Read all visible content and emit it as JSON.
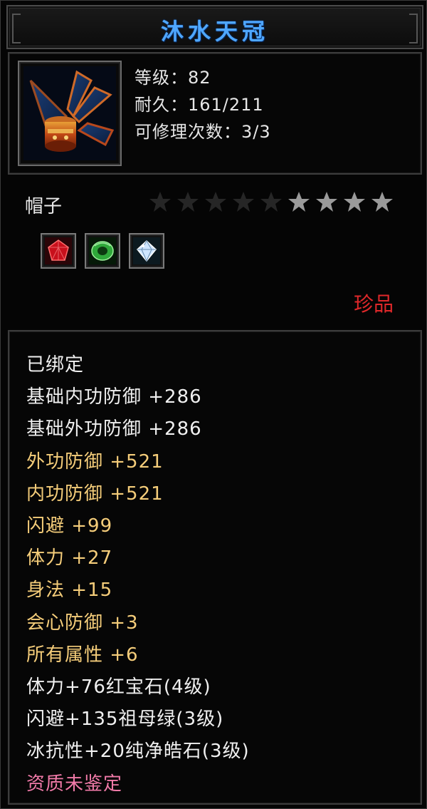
{
  "item": {
    "name": "沐水天冠",
    "level_text": "等级：82",
    "durability_text": "耐久：161/211",
    "repair_text": "可修理次数：3/3",
    "subtype": "帽子",
    "stars_total": 9,
    "stars_lit": 4,
    "rarity": "珍品"
  },
  "gems": [
    {
      "icon": "ruby-gem-icon",
      "color": "#c8101c"
    },
    {
      "icon": "emerald-gem-icon",
      "color": "#2fa83a"
    },
    {
      "icon": "diamond-gem-icon",
      "color": "#cfe6ff"
    }
  ],
  "attributes": [
    {
      "text": "已绑定",
      "color": "white"
    },
    {
      "text": "基础内功防御  +286",
      "color": "white"
    },
    {
      "text": "基础外功防御  +286",
      "color": "white"
    },
    {
      "text": "外功防御  +521",
      "color": "gold"
    },
    {
      "text": "内功防御  +521",
      "color": "gold"
    },
    {
      "text": "闪避  +99",
      "color": "gold"
    },
    {
      "text": "体力  +27",
      "color": "gold"
    },
    {
      "text": "身法  +15",
      "color": "gold"
    },
    {
      "text": "会心防御  +3",
      "color": "gold"
    },
    {
      "text": "所有属性  +6",
      "color": "gold"
    },
    {
      "text": "体力+76红宝石(4级)",
      "color": "white"
    },
    {
      "text": "闪避+135祖母绿(3级)",
      "color": "white"
    },
    {
      "text": "冰抗性+20纯净皓石(3级)",
      "color": "white"
    },
    {
      "text": "资质未鉴定",
      "color": "pink"
    }
  ],
  "colors": {
    "title": "#4fa7ff",
    "rarity": "#e0282a",
    "gold": "#f5cd7a",
    "pink": "#f07aa8",
    "star_lit": "#9a9a9a",
    "star_dim": "#262626"
  }
}
